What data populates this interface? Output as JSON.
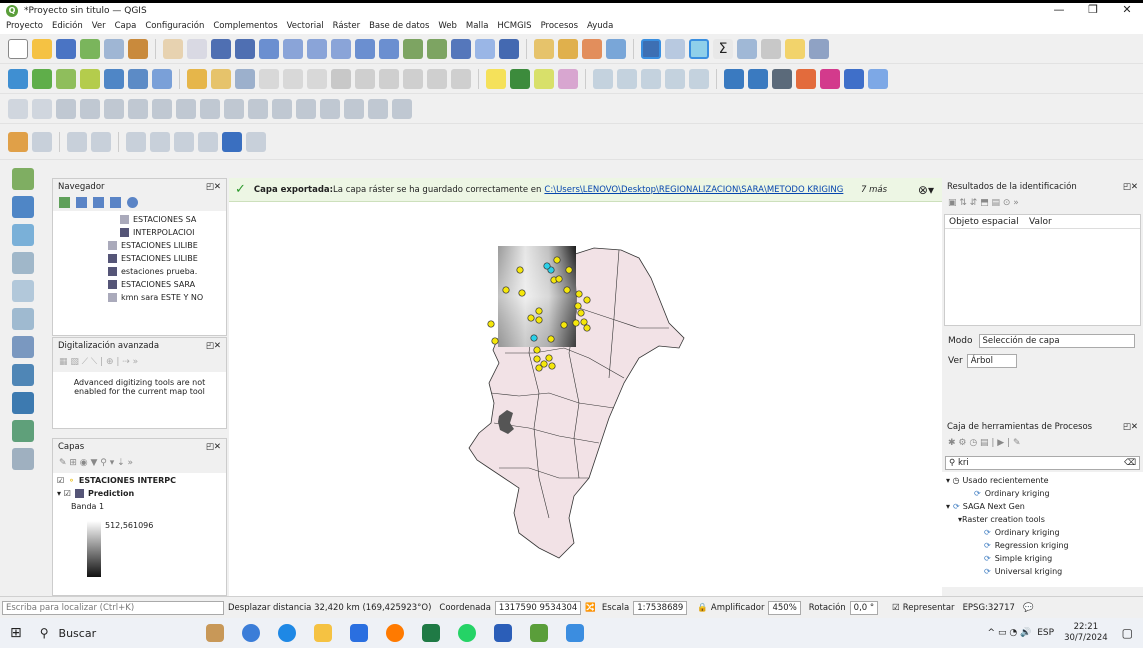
{
  "window": {
    "title": "*Proyecto sin titulo — QGIS",
    "minimize": "—",
    "maximize": "❐",
    "close": "✕"
  },
  "menu": [
    "Proyecto",
    "Edición",
    "Ver",
    "Capa",
    "Configuración",
    "Complementos",
    "Vectorial",
    "Ráster",
    "Base de datos",
    "Web",
    "Malla",
    "HCMGIS",
    "Procesos",
    "Ayuda"
  ],
  "navigator": {
    "title": "Navegador",
    "items": [
      "ESTACIONES SA",
      "INTERPOLACIOI",
      "ESTACIONES LILIBE",
      "ESTACIONES LILIBE",
      "estaciones prueba.",
      "ESTACIONES SARA",
      "kmn sara ESTE Y NO"
    ]
  },
  "digitizing": {
    "title": "Digitalización avanzada",
    "message": "Advanced digitizing tools are not enabled for the current map tool"
  },
  "layers": {
    "title": "Capas",
    "items": [
      {
        "name": "ESTACIONES INTERPC"
      },
      {
        "name": "Prediction"
      }
    ],
    "band": "Banda 1",
    "value": "512,561096"
  },
  "message": {
    "bold": "Capa exportada:",
    "text": " La capa ráster se ha guardado correctamente en ",
    "link": "C:\\Users\\LENOVO\\Desktop\\REGIONALIZACION\\SARA\\METODO KRIGING",
    "more": "7 más"
  },
  "identify": {
    "title": "Resultados de la identificación",
    "col1": "Objeto espacial",
    "col2": "Valor",
    "mode_label": "Modo",
    "mode_value": "Selección de capa",
    "view_label": "Ver",
    "view_value": "Árbol"
  },
  "toolbox": {
    "title": "Caja de herramientas de Procesos",
    "search": "kri",
    "recent": "Usado recientemente",
    "recent_item": "Ordinary kriging",
    "provider": "SAGA Next Gen",
    "group": "Raster creation tools",
    "tools": [
      "Ordinary kriging",
      "Regression kriging",
      "Simple kriging",
      "Universal kriging"
    ]
  },
  "status": {
    "locator": "Escriba para localizar (Ctrl+K)",
    "pan": "Desplazar distancia 32,420 km (169,425923°O)",
    "coord_label": "Coordenada",
    "coord": "1317590 9534304",
    "scale_label": "Escala",
    "scale": "1:7538689",
    "magnifier_label": "Amplificador",
    "magnifier": "450%",
    "rotation_label": "Rotación",
    "rotation": "0,0 °",
    "render_label": "Representar",
    "crs": "EPSG:32717"
  },
  "taskbar": {
    "search": "Buscar",
    "lang": "ESP",
    "time": "22:21",
    "date": "30/7/2024"
  },
  "colors": {
    "map_fill": "#f2e2e6",
    "point": "#f5e70a",
    "point_alt": "#2bd0e8",
    "msg_bg": "#edf6e4"
  }
}
